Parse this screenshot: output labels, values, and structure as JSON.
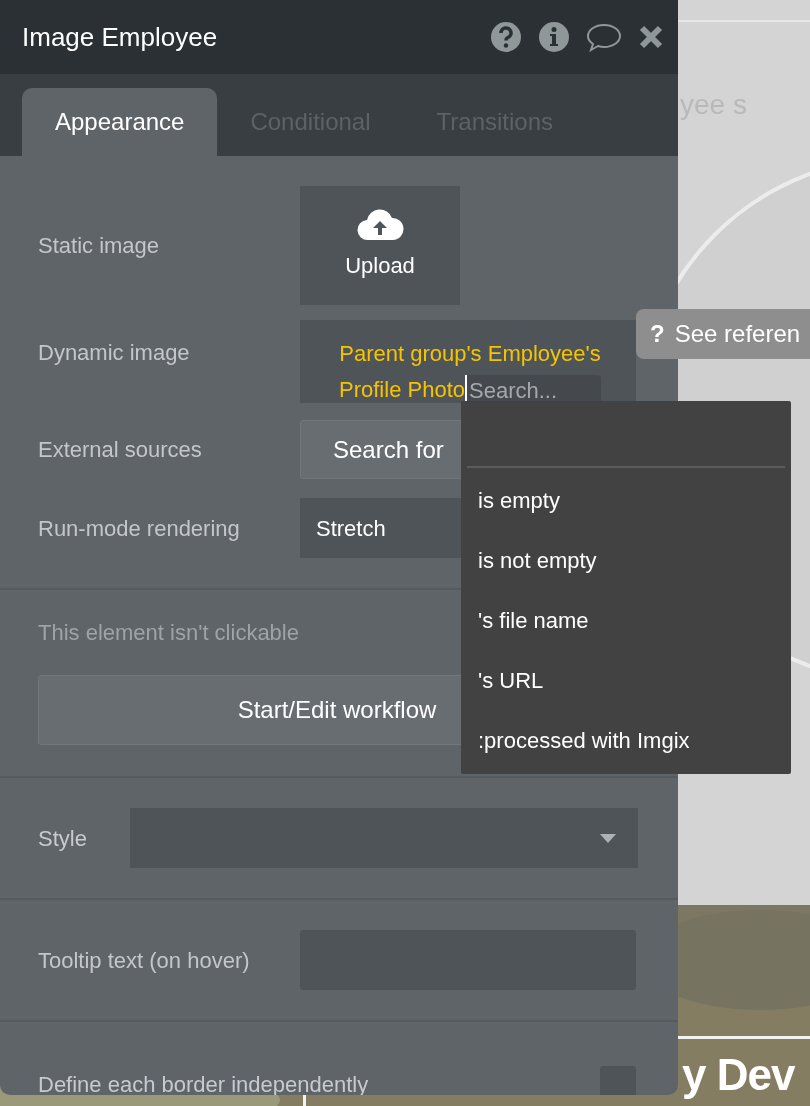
{
  "panel": {
    "title": "Image Employee"
  },
  "tabs": [
    {
      "label": "Appearance",
      "selected": true
    },
    {
      "label": "Conditional",
      "selected": false
    },
    {
      "label": "Transitions",
      "selected": false
    }
  ],
  "rows": [
    {
      "kind": "upload",
      "label": "Static image",
      "button": "Upload"
    },
    {
      "kind": "expression",
      "label": "Dynamic image",
      "value": "Parent group's Employee's Profile Photo",
      "search_placeholder": "Search..."
    },
    {
      "kind": "button",
      "label": "External sources",
      "button": "Search for"
    },
    {
      "kind": "select",
      "label": "Run-mode rendering",
      "value": "Stretch"
    }
  ],
  "workflow": {
    "note": "This element isn't clickable",
    "button": "Start/Edit workflow"
  },
  "style": {
    "label": "Style"
  },
  "tooltip_field": {
    "label": "Tooltip text (on hover)"
  },
  "border_option": {
    "label": "Define each border independently",
    "checked": false
  },
  "dropdown": {
    "items": [
      "is empty",
      "is not empty",
      "'s file name",
      "'s URL",
      ":processed with Imgix"
    ]
  },
  "help_tooltip": {
    "icon": "?",
    "text": "See referen"
  },
  "canvas": {
    "faded_text": "yee s",
    "heading": "y Dev"
  }
}
